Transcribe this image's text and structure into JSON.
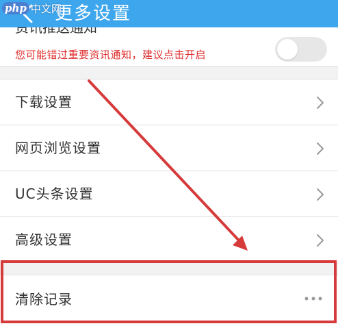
{
  "header": {
    "title": "更多设置",
    "watermark_logo": "php",
    "watermark_text": "中文网",
    "icons": {
      "back": "back-arrow-icon"
    },
    "color": "#3ea6ec"
  },
  "push_notify": {
    "title": "资讯推送通知",
    "description": "您可能错过重要资讯通知，建议点击开启",
    "toggle_on": false,
    "description_color": "#e02d2d"
  },
  "menu": {
    "items": [
      {
        "label": "下载设置"
      },
      {
        "label": "网页浏览设置"
      },
      {
        "label": "UC头条设置"
      },
      {
        "label": "高级设置"
      }
    ],
    "clear": {
      "label": "清除记录"
    },
    "icons": {
      "item": "chevron-right-icon",
      "clear": "more-dots-icon"
    }
  },
  "annotation": {
    "color": "#d63a3a"
  }
}
